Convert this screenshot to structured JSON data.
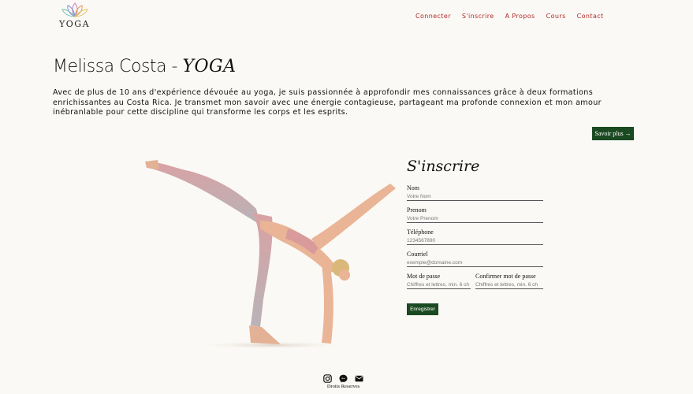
{
  "brand": {
    "name": "YOGA",
    "logo_icon": "lotus-icon"
  },
  "nav": {
    "items": [
      "Connecter",
      "S'inscrire",
      "A Propos",
      "Cours",
      "Contact"
    ],
    "color": "#b12a2a"
  },
  "hero": {
    "title_plain": "Melissa Costa - ",
    "title_accent": "YOGA",
    "intro": "Avec de plus de 10 ans d'expérience dévouée au yoga, je suis passionnée à approfondir mes connaissances grâce à deux formations enrichissantes au Costa Rica. Je transmet mon savoir avec une énergie contagieuse, partageant ma profonde connexion et mon amour inébranlable pour cette discipline qui transforme les corps et les esprits.",
    "more_button": "Savoir plus →"
  },
  "form": {
    "title": "S'inscrire",
    "fields": [
      {
        "label": "Nom",
        "placeholder": "Votre Nom"
      },
      {
        "label": "Prenom",
        "placeholder": "Votre Prenom"
      },
      {
        "label": "Téléphone",
        "placeholder": "1234567890"
      },
      {
        "label": "Courriel",
        "placeholder": "exemple@domaine.com"
      },
      {
        "label": "Mot de passe",
        "placeholder": "Chiffres et lettres, min. 6 ch"
      },
      {
        "label": "Confirmer mot de passe",
        "placeholder": "Chiffres et lettres, min. 6 ch"
      }
    ],
    "submit": "Enregistrer",
    "accent": "#1b4a22"
  },
  "footer": {
    "icons": [
      "instagram-icon",
      "messenger-icon",
      "mail-icon"
    ],
    "text": "Droits Reserves"
  }
}
